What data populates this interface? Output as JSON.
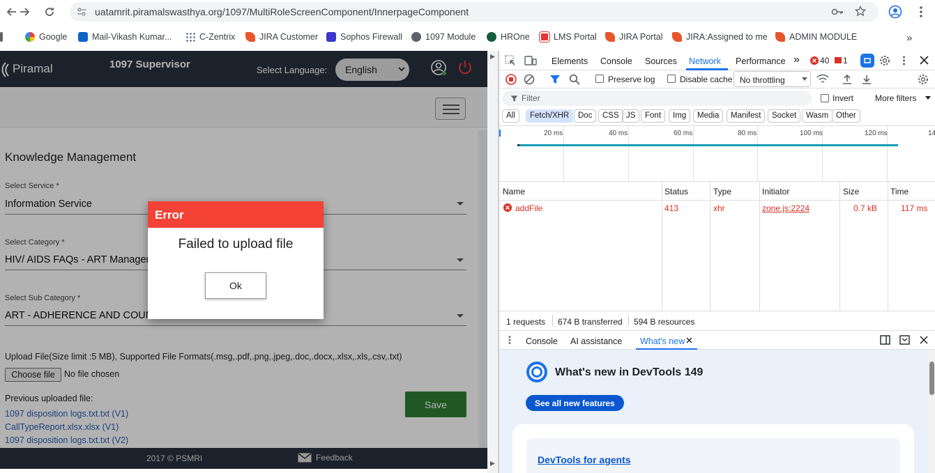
{
  "browser": {
    "url": "uatamrit.piramalswasthya.org/1097/MultiRoleScreenComponent/InnerpageComponent",
    "bookmarks": [
      "Google",
      "Mail-Vikash Kumar...",
      "C-Zentrix",
      "JIRA Customer",
      "Sophos Firewall",
      "1097 Module",
      "HROne",
      "LMS Portal",
      "JIRA Portal",
      "JIRA:Assigned to me",
      "ADMIN MODULE"
    ],
    "more_bookmarks": "»"
  },
  "app": {
    "brand": "Piramal",
    "role_title": "1097 Supervisor",
    "language_label": "Select Language:",
    "language_value": "English",
    "page_title": "Knowledge Management",
    "service_label": "Select Service *",
    "service_value": "Information Service",
    "category_label": "Select Category *",
    "category_value": "HIV/ AIDS FAQs - ART Managem",
    "subcategory_label": "Select Sub Category *",
    "subcategory_value": "ART - ADHERENCE AND COUNSELLING",
    "upload_label": "Upload File(Size limit :5 MB), Supported File Formats(.msg,.pdf,.png,.jpeg,.doc,.docx,.xlsx,.xls,.csv,.txt)",
    "choose_file": "Choose file",
    "no_file": "No file chosen",
    "previous_label": "Previous uploaded file:",
    "previous_files": [
      "1097 disposition logs.txt.txt (V1)",
      "CallTypeReport.xlsx.xlsx (V1)",
      "1097 disposition logs.txt.txt (V2)"
    ],
    "save": "Save",
    "footer_copyright": "2017 © PSMRI",
    "footer_feedback": "Feedback"
  },
  "dialog": {
    "title": "Error",
    "message": "Failed to upload file",
    "ok": "Ok"
  },
  "devtools": {
    "tabs": [
      "Elements",
      "Console",
      "Sources",
      "Network",
      "Performance"
    ],
    "active_tab": "Network",
    "more_tabs": "»",
    "error_count": "40",
    "warning_count": "1",
    "preserve_log": "Preserve log",
    "disable_cache": "Disable cache",
    "throttling": "No throttling",
    "filter_placeholder": "Filter",
    "invert": "Invert",
    "more_filters": "More filters",
    "type_filters": [
      "All",
      "Fetch/XHR",
      "Doc",
      "CSS",
      "JS",
      "Font",
      "Img",
      "Media",
      "Manifest",
      "Socket",
      "Wasm",
      "Other"
    ],
    "active_type_filter": "Fetch/XHR",
    "timeline_ticks": [
      "20 ms",
      "40 ms",
      "60 ms",
      "80 ms",
      "100 ms",
      "120 ms",
      "14"
    ],
    "columns": [
      "Name",
      "Status",
      "Type",
      "Initiator",
      "Size",
      "Time"
    ],
    "rows": [
      {
        "name": "addFile",
        "status": "413",
        "type": "xhr",
        "initiator": "zone.js:2224",
        "size": "0.7 kB",
        "time": "117 ms"
      }
    ],
    "summary": {
      "requests": "1 requests",
      "transferred": "674 B transferred",
      "resources": "594 B resources"
    },
    "drawer_tabs": [
      "Console",
      "AI assistance",
      "What's new"
    ],
    "whats_new_title": "What's new in DevTools 149",
    "see_all": "See all new features",
    "card_link": "DevTools for agents"
  },
  "colors": {
    "app_header": "#28313e",
    "dialog_header": "#f44336",
    "save_button": "#2e7d32",
    "devtools_accent": "#1a73e8",
    "error_red": "#d93025"
  }
}
